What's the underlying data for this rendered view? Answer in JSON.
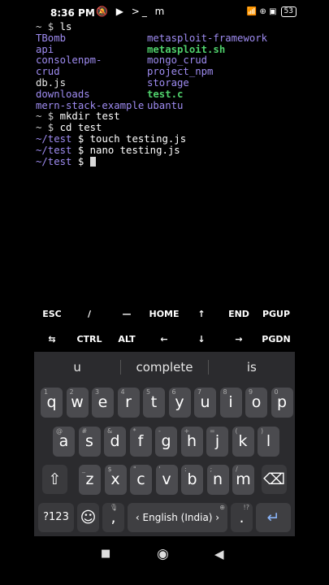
{
  "status_bar": {
    "time": "8:36 PM",
    "left_icons": "🔕 ▶ >_ m",
    "right_icons": "📶 ⊕ ▣",
    "battery": "53"
  },
  "terminal": {
    "prompt_home": "~ $ ",
    "cmd_ls": "ls",
    "ls_left": [
      {
        "text": "TBomb",
        "kind": "dir"
      },
      {
        "text": "api",
        "kind": "dir"
      },
      {
        "text": "consolenpm-",
        "kind": "dir"
      },
      {
        "text": "crud",
        "kind": "dir"
      },
      {
        "text": "db.js",
        "kind": "file"
      },
      {
        "text": "downloads",
        "kind": "dir"
      },
      {
        "text": "mern-stack-example",
        "kind": "dir"
      }
    ],
    "ls_right": [
      {
        "text": "metasploit-framework",
        "kind": "dir"
      },
      {
        "text": "metasploit.sh",
        "kind": "exec"
      },
      {
        "text": "mongo_crud",
        "kind": "dir"
      },
      {
        "text": "project_npm",
        "kind": "dir"
      },
      {
        "text": "storage",
        "kind": "dir"
      },
      {
        "text": "test.c",
        "kind": "exec"
      },
      {
        "text": "ubantu",
        "kind": "dir"
      }
    ],
    "cmd_mkdir": "mkdir test",
    "cmd_cd": "cd test",
    "test_dir": "~/test",
    "dollar": " $ ",
    "cmd_touch": "touch testing.js",
    "cmd_nano": "nano testing.js"
  },
  "extra_keys": {
    "row1": [
      "ESC",
      "/",
      "—",
      "HOME",
      "↑",
      "END",
      "PGUP"
    ],
    "row2": [
      "⇆",
      "CTRL",
      "ALT",
      "←",
      "↓",
      "→",
      "PGDN"
    ]
  },
  "keyboard": {
    "suggestions": [
      "u",
      "complete",
      "is"
    ],
    "row1": [
      {
        "k": "q",
        "s": "1"
      },
      {
        "k": "w",
        "s": "2"
      },
      {
        "k": "e",
        "s": "3"
      },
      {
        "k": "r",
        "s": "4"
      },
      {
        "k": "t",
        "s": "5"
      },
      {
        "k": "y",
        "s": "6"
      },
      {
        "k": "u",
        "s": "7"
      },
      {
        "k": "i",
        "s": "8"
      },
      {
        "k": "o",
        "s": "9"
      },
      {
        "k": "p",
        "s": "0"
      }
    ],
    "row2": [
      {
        "k": "a",
        "s": "@"
      },
      {
        "k": "s",
        "s": "#"
      },
      {
        "k": "d",
        "s": "&"
      },
      {
        "k": "f",
        "s": "*"
      },
      {
        "k": "g",
        "s": "-"
      },
      {
        "k": "h",
        "s": "+"
      },
      {
        "k": "j",
        "s": "="
      },
      {
        "k": "k",
        "s": "("
      },
      {
        "k": "l",
        "s": ")"
      }
    ],
    "row3": [
      {
        "k": "z",
        "s": "_"
      },
      {
        "k": "x",
        "s": "$"
      },
      {
        "k": "c",
        "s": "\""
      },
      {
        "k": "v",
        "s": "'"
      },
      {
        "k": "b",
        "s": ":"
      },
      {
        "k": "n",
        "s": ";"
      },
      {
        "k": "m",
        "s": "/"
      }
    ],
    "shift": "⇧",
    "backspace": "⌫",
    "symbols": "?123",
    "emoji": "☺",
    "comma": ",",
    "mic": "🎙",
    "space_label": "‹  English (India)  ›",
    "globe": "⊕",
    "period": ".",
    "period_sup": "!?",
    "enter": "↵"
  },
  "nav_bar": {
    "recents": "■",
    "home": "◉",
    "back": "◀"
  }
}
